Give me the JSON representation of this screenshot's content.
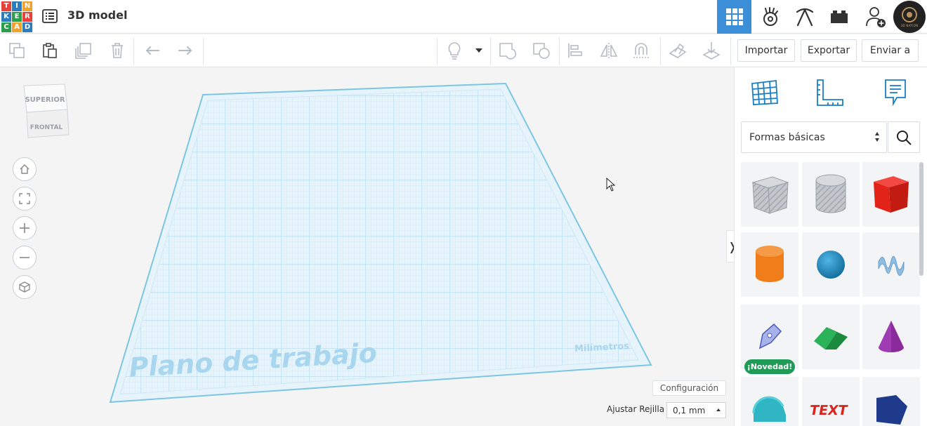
{
  "app": {
    "title": "3D model",
    "logo_letters": [
      "T",
      "I",
      "N",
      "K",
      "E",
      "R",
      "C",
      "A",
      "D"
    ],
    "logo_colors": [
      "#e8413b",
      "#2c7cc0",
      "#f2a22b",
      "#2c7cc0",
      "#2c9e4e",
      "#e8413b",
      "#2c9e4e",
      "#f2a22b",
      "#2c7cc0"
    ]
  },
  "topnav": {
    "active_view": "3D",
    "avatar_text": "3D NATION",
    "accent": "#3b8fd8"
  },
  "toolbar": {
    "import_label": "Importar",
    "export_label": "Exportar",
    "send_label": "Enviar a"
  },
  "viewcube": {
    "top_label": "SUPERIOR",
    "front_label": "FRONTAL"
  },
  "workspace": {
    "workplane_label": "Plano de trabajo",
    "units_label": "Milímetros",
    "settings_label": "Configuración",
    "grid_label": "Ajustar Rejilla",
    "grid_value": "0,1 mm"
  },
  "panel": {
    "category_label": "Formas básicas",
    "new_badge": "¡Novedad!",
    "shapes": [
      {
        "name": "box-hole",
        "color": "#b9bcc2"
      },
      {
        "name": "cylinder-hole",
        "color": "#b9bcc2"
      },
      {
        "name": "box",
        "color": "#e2231a"
      },
      {
        "name": "cylinder",
        "color": "#f07d1a"
      },
      {
        "name": "sphere",
        "color": "#1f8fc7"
      },
      {
        "name": "scribble",
        "color": "#7fb0d8"
      },
      {
        "name": "shape-generator",
        "color": "#7b8fd6"
      },
      {
        "name": "roof",
        "color": "#1e9a43"
      },
      {
        "name": "cone",
        "color": "#8a2b9b"
      },
      {
        "name": "round-roof",
        "color": "#2fb5c4"
      },
      {
        "name": "text",
        "color": "#d7261f"
      },
      {
        "name": "polygon",
        "color": "#1f3a8a"
      }
    ]
  }
}
